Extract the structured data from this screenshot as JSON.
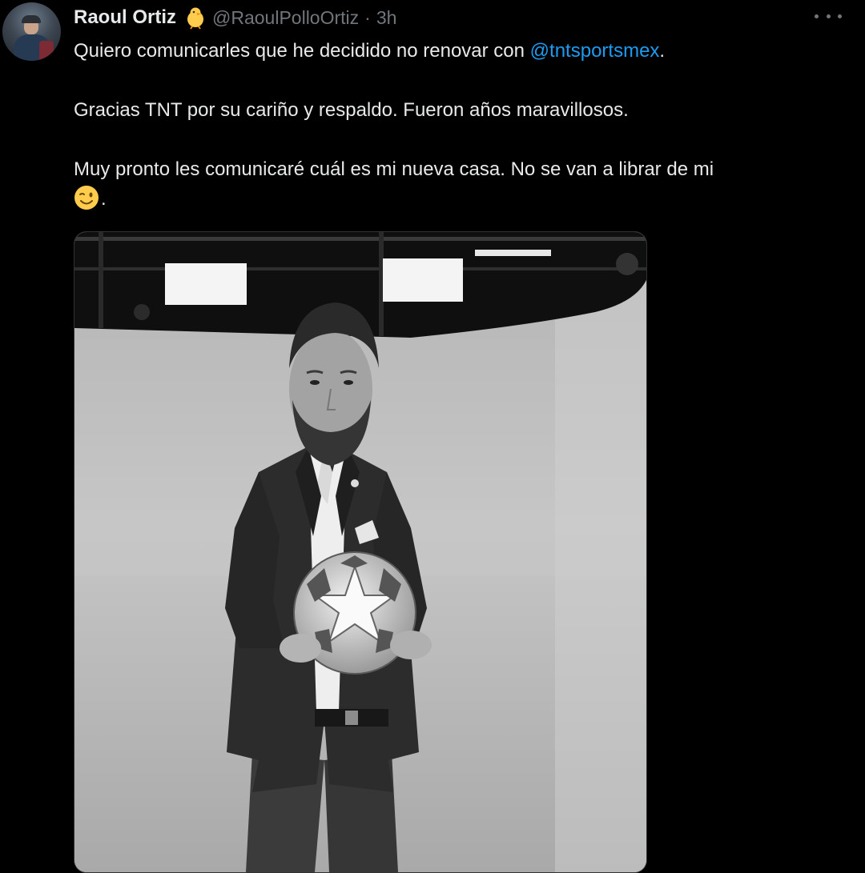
{
  "author": {
    "name": "Raoul Ortiz",
    "badge_icon": "chick-emoji",
    "handle": "@RaoulPolloOrtiz",
    "separator": "·",
    "time": "3h"
  },
  "tweet": {
    "line1_prefix": "Quiero comunicarles que he decidido no renovar con ",
    "mention": "@tntsportsmex",
    "line1_suffix": ".",
    "paragraph2": "Gracias TNT por su cariño y respaldo. Fueron años maravillosos.",
    "paragraph3": "Muy pronto les comunicaré cuál es mi nueva casa. No se van a librar de mi",
    "paragraph3_emoji": "winking-face-emoji",
    "paragraph3_suffix": "."
  },
  "colors": {
    "background": "#000000",
    "text": "#e7e9ea",
    "secondary_text": "#71767b",
    "link": "#1d9bf0"
  }
}
